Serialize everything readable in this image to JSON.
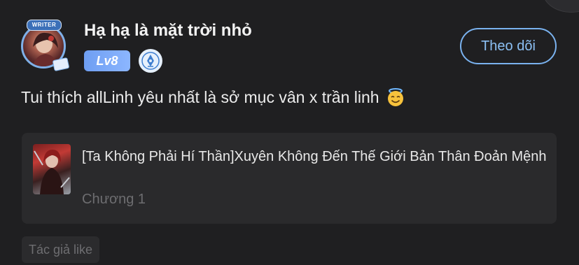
{
  "author": {
    "name": "Hạ hạ là mặt trời nhỏ",
    "avatar_badge_text": "WRITER",
    "level": "Lv8",
    "writer_icon": "pen-nib-icon"
  },
  "follow_button": {
    "label": "Theo dõi"
  },
  "comment": {
    "text": "Tui thích allLinh yêu nhất là sở mục vân x trần linh",
    "emoji": "smiling-face-with-halo"
  },
  "book": {
    "title": "[Ta Không Phải Hí Thần]Xuyên Không Đến Thế Giới Bản Thân Đoản Mệnh",
    "chapter": "Chương 1"
  },
  "tags": [
    "Tác giả like"
  ],
  "colors": {
    "background": "#1f1f21",
    "accent": "#7ab2ef",
    "level_badge": "#7aa8f6",
    "card": "#2a2a2c"
  }
}
